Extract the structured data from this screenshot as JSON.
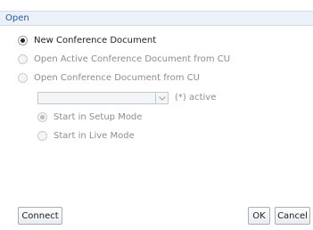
{
  "dialog": {
    "title": "Open"
  },
  "options": {
    "new_doc": "New Conference Document",
    "open_active": "Open Active Conference Document from CU",
    "open_from_cu": "Open Conference Document from CU"
  },
  "document_select": {
    "value": "",
    "suffix": "(*) active"
  },
  "mode": {
    "setup": "Start in Setup Mode",
    "live": "Start in Live Mode"
  },
  "buttons": {
    "connect": "Connect",
    "ok": "OK",
    "cancel": "Cancel"
  }
}
